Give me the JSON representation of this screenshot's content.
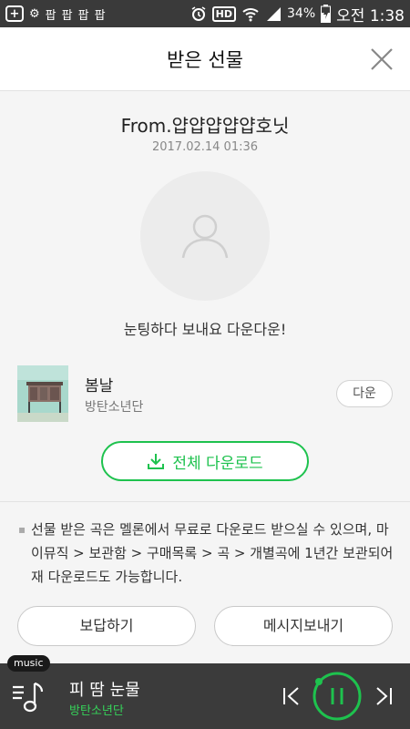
{
  "status_bar": {
    "notif_glyphs": [
      "+",
      "⚙",
      "팝",
      "팝",
      "팝",
      "팝"
    ],
    "icons": [
      "add-icon",
      "settings-icon",
      "alarm-icon",
      "hd-icon",
      "wifi-icon",
      "signal-icon",
      "battery-icon"
    ],
    "hd": "HD",
    "battery": "34%",
    "time": "오전 1:38"
  },
  "header": {
    "title": "받은 선물"
  },
  "gift": {
    "from": "From.얍얍얍얍얍호닛",
    "date": "2017.02.14 01:36",
    "message": "눈팅하다 보내요 다운다운!"
  },
  "song": {
    "title": "봄날",
    "artist": "방탄소년단",
    "download_label": "다운"
  },
  "all_download": {
    "label": "전체 다운로드"
  },
  "notice": "선물 받은 곡은 멜론에서 무료로 다운로드 받으실 수 있으며, 마이뮤직 > 보관함 > 구매목록 > 곡 > 개별곡에 1년간 보관되어 재 다운로드도 가능합니다.",
  "buttons": {
    "reply": "보답하기",
    "send_message": "메시지보내기"
  },
  "player": {
    "tag": "music",
    "title": "피 땀 눈물",
    "artist": "방탄소년단",
    "state": "playing"
  },
  "colors": {
    "accent": "#1ec24e",
    "player_bg": "#3b3b3b",
    "status_bar": "#3a3a3a"
  }
}
